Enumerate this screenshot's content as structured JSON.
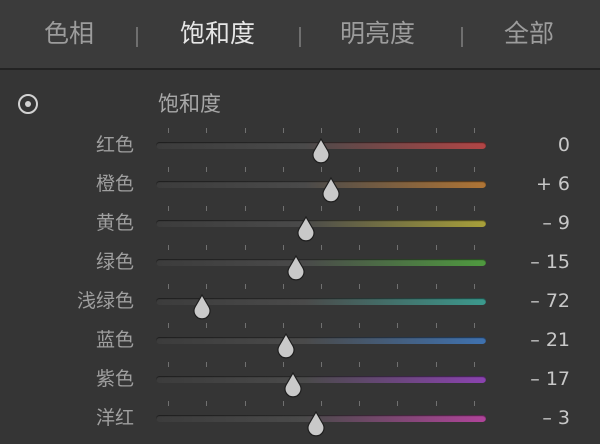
{
  "tabs": [
    {
      "label": "色相",
      "active": false
    },
    {
      "label": "饱和度",
      "active": true
    },
    {
      "label": "明亮度",
      "active": false
    },
    {
      "label": "全部",
      "active": false
    }
  ],
  "tab_separator": "|",
  "section": {
    "title": "饱和度",
    "target_icon": "target-adjust-icon"
  },
  "colors": {
    "background": "#353535",
    "tab_bar": "#3b3b3b",
    "thumb": "#c9c9c9"
  },
  "sliders": [
    {
      "label": "红色",
      "value": "0",
      "numeric": 0,
      "track_from": "#3c3c3c",
      "track_to": "#b24545"
    },
    {
      "label": "橙色",
      "value": "+ 6",
      "numeric": 6,
      "track_from": "#3c3c3c",
      "track_to": "#b07535"
    },
    {
      "label": "黄色",
      "value": "– 9",
      "numeric": -9,
      "track_from": "#3c3c3c",
      "track_to": "#a8a03a"
    },
    {
      "label": "绿色",
      "value": "– 15",
      "numeric": -15,
      "track_from": "#3c3c3c",
      "track_to": "#4f9a3f"
    },
    {
      "label": "浅绿色",
      "value": "– 72",
      "numeric": -72,
      "track_from": "#3c3c3c",
      "track_to": "#3c9a8e"
    },
    {
      "label": "蓝色",
      "value": "– 21",
      "numeric": -21,
      "track_from": "#3c3c3c",
      "track_to": "#3f72b0"
    },
    {
      "label": "紫色",
      "value": "– 17",
      "numeric": -17,
      "track_from": "#3c3c3c",
      "track_to": "#8b43b0"
    },
    {
      "label": "洋红",
      "value": "– 3",
      "numeric": -3,
      "track_from": "#3c3c3c",
      "track_to": "#b0449a"
    }
  ]
}
